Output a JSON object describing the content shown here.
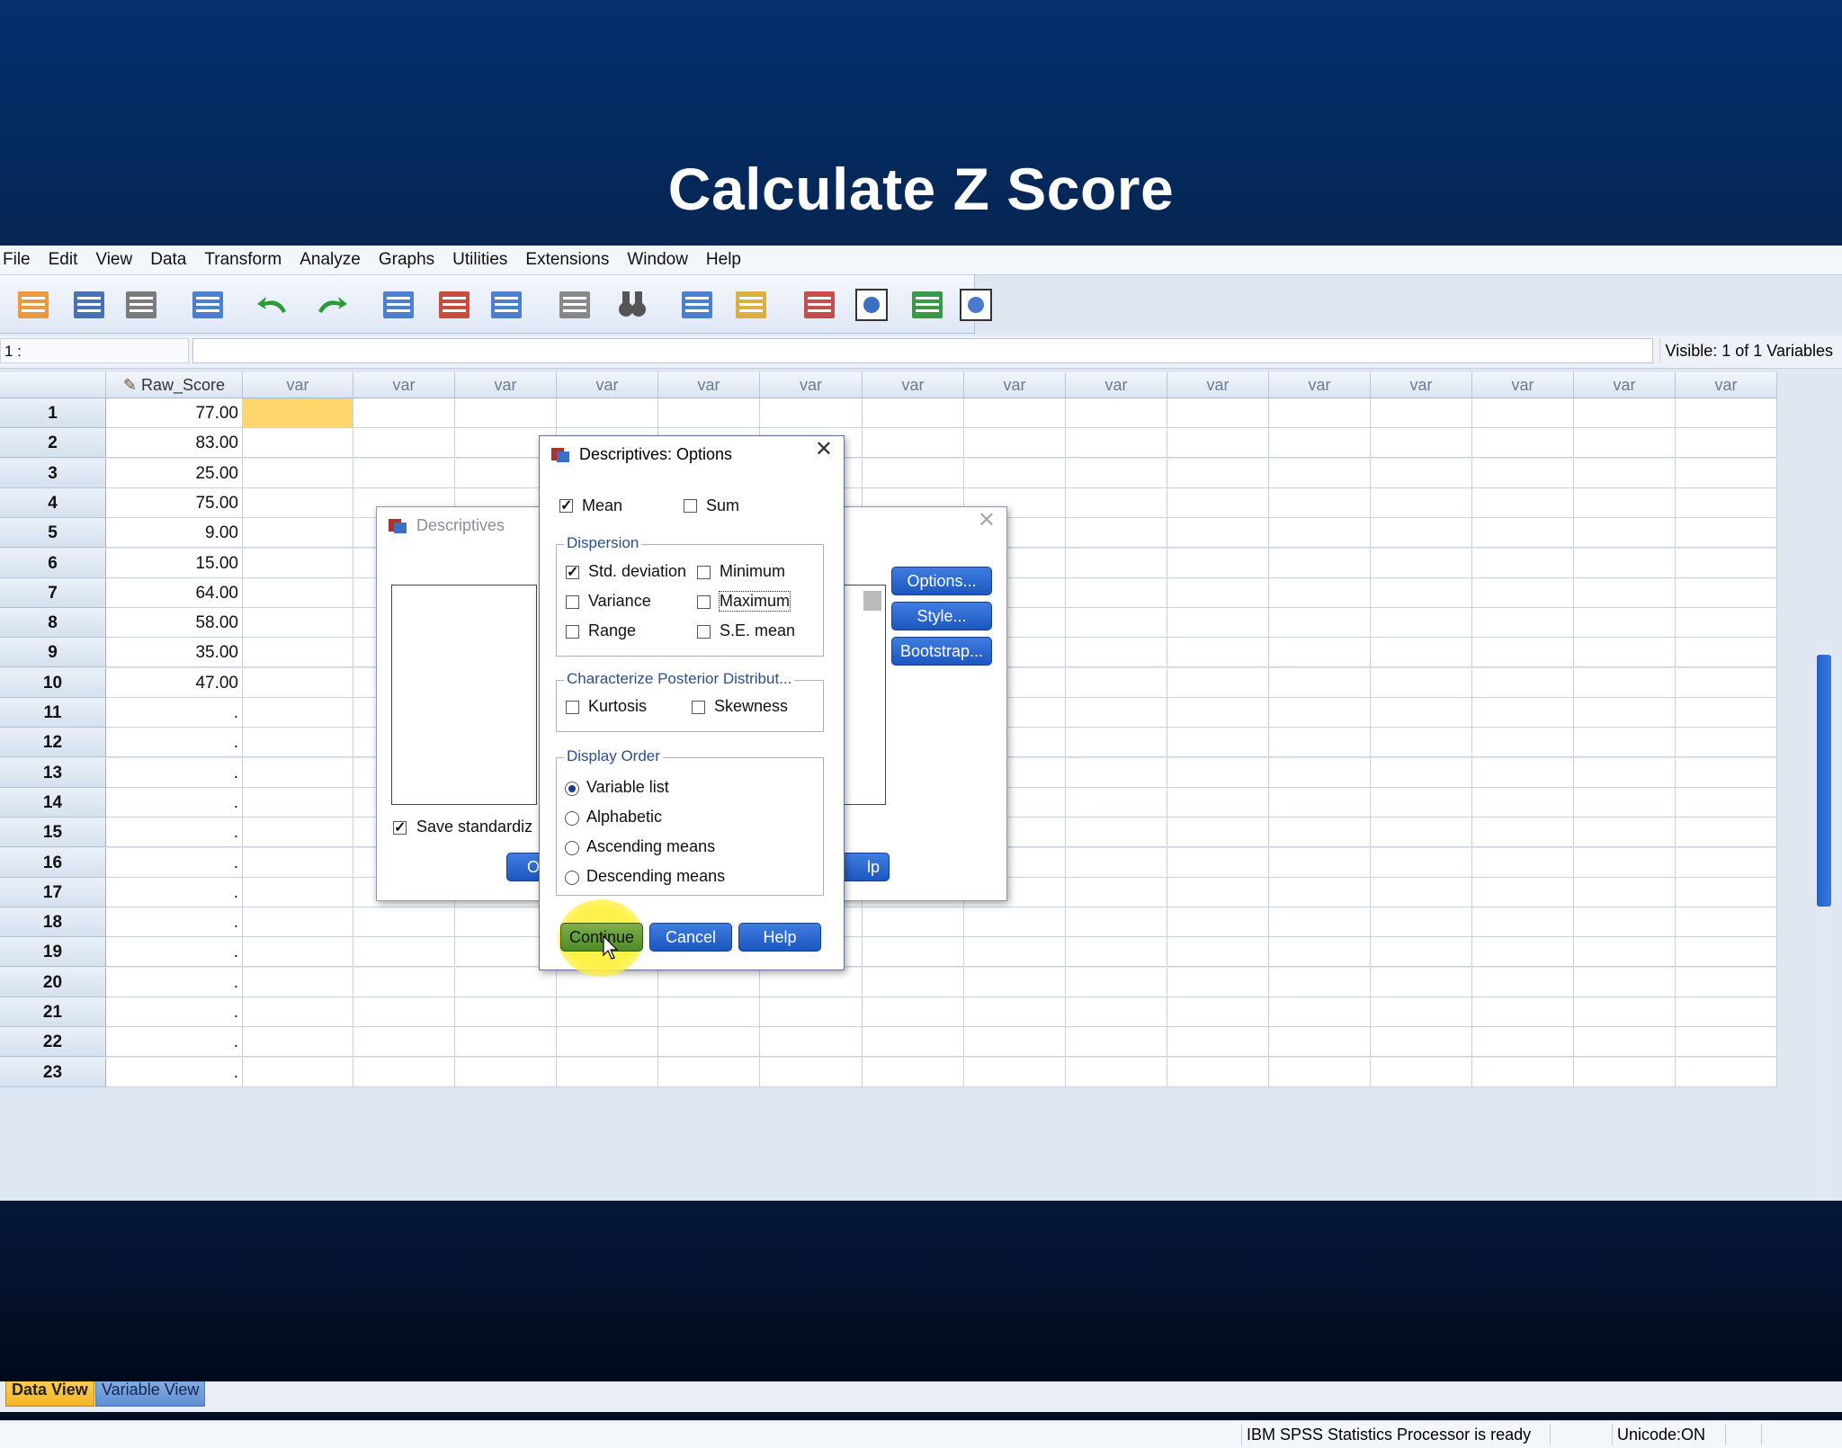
{
  "slide": {
    "title": "Calculate Z Score"
  },
  "menu": [
    "File",
    "Edit",
    "View",
    "Data",
    "Transform",
    "Analyze",
    "Graphs",
    "Utilities",
    "Extensions",
    "Window",
    "Help"
  ],
  "toolbar": {
    "icons": [
      "open-icon",
      "save-icon",
      "print-icon",
      "dialog-recall-icon",
      "undo-icon",
      "redo-icon",
      "goto-case-icon",
      "goto-variable-icon",
      "variables-icon",
      "run-descriptive-icon",
      "find-icon",
      "insert-cases-icon",
      "insert-variable-icon",
      "split-file-icon",
      "weight-cases-icon",
      "select-cases-icon",
      "value-labels-icon",
      "use-sets-icon"
    ]
  },
  "cellbar": {
    "ref": "1 :",
    "visible": "Visible: 1 of 1 Variables"
  },
  "grid": {
    "first_column": "Raw_Score",
    "var_label": "var",
    "rows": [
      "1",
      "2",
      "3",
      "4",
      "5",
      "6",
      "7",
      "8",
      "9",
      "10",
      "11",
      "12",
      "13",
      "14",
      "15",
      "16",
      "17",
      "18",
      "19",
      "20",
      "21",
      "22",
      "23"
    ],
    "values": [
      "77.00",
      "83.00",
      "25.00",
      "75.00",
      "9.00",
      "15.00",
      "64.00",
      "58.00",
      "35.00",
      "47.00",
      ".",
      ".",
      ".",
      ".",
      ".",
      ".",
      ".",
      ".",
      ".",
      ".",
      ".",
      ".",
      "."
    ]
  },
  "tabs": {
    "data_view": "Data View",
    "variable_view": "Variable View"
  },
  "status": {
    "processor": "IBM SPSS Statistics Processor is ready",
    "unicode": "Unicode:ON"
  },
  "descriptives": {
    "title": "Descriptives",
    "buttons": {
      "options": "Options...",
      "style": "Style...",
      "bootstrap": "Bootstrap..."
    },
    "save_label": "Save standardiz",
    "save_checked": true,
    "bottom_left_fragment": "O",
    "bottom_right_fragment": "lp"
  },
  "options": {
    "title": "Descriptives: Options",
    "mean": {
      "label": "Mean",
      "checked": true
    },
    "sum": {
      "label": "Sum",
      "checked": false
    },
    "dispersion": {
      "title": "Dispersion",
      "items": [
        {
          "label": "Std. deviation",
          "checked": true
        },
        {
          "label": "Minimum",
          "checked": false
        },
        {
          "label": "Variance",
          "checked": false
        },
        {
          "label": "Maximum",
          "checked": false
        },
        {
          "label": "Range",
          "checked": false
        },
        {
          "label": "S.E. mean",
          "checked": false
        }
      ]
    },
    "posterior": {
      "title": "Characterize Posterior Distribut...",
      "items": [
        {
          "label": "Kurtosis",
          "checked": false
        },
        {
          "label": "Skewness",
          "checked": false
        }
      ]
    },
    "display_order": {
      "title": "Display Order",
      "items": [
        {
          "label": "Variable list",
          "selected": true
        },
        {
          "label": "Alphabetic",
          "selected": false
        },
        {
          "label": "Ascending means",
          "selected": false
        },
        {
          "label": "Descending means",
          "selected": false
        }
      ]
    },
    "buttons": {
      "continue": "Continue",
      "cancel": "Cancel",
      "help": "Help"
    }
  },
  "colors": {
    "slide_bg": "#052a5e",
    "accent_button": "#1d56bf",
    "selected_cell": "#ffd66b",
    "highlight": "#fff14a"
  }
}
